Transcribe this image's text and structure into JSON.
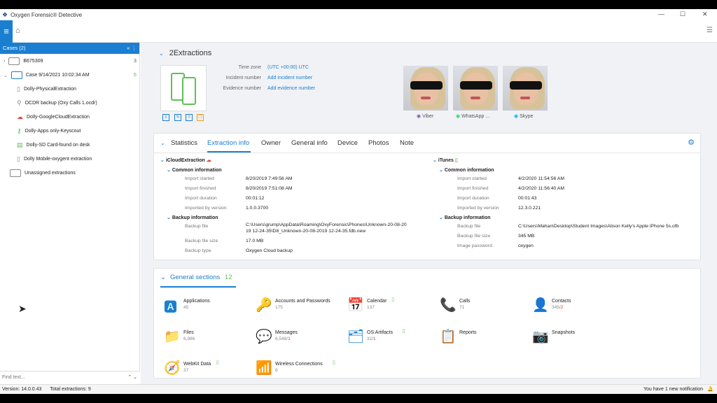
{
  "app": {
    "title": "Oxygen Forensic® Detective"
  },
  "sidebar": {
    "header": "Cases (2)",
    "items": [
      {
        "label": "B675309",
        "count": "3"
      },
      {
        "label": "Case 9/14/2021 10:02:34 AM",
        "count": "6"
      },
      {
        "label": "Dolly-PhysicalExtraction"
      },
      {
        "label": "OCDR backup (Oxy Calls 1.ocdr)"
      },
      {
        "label": "Dolly-GoogleCloudExtraction"
      },
      {
        "label": "Dolly-Apps only-Keyscout"
      },
      {
        "label": "Dolly-SD Card-found on desk"
      },
      {
        "label": "Dolly Mobile-oxygent extraction"
      },
      {
        "label": "Unassigned extractions"
      }
    ],
    "find_placeholder": "Find text..."
  },
  "status": {
    "version": "Version: 14.0.0.43",
    "total": "Total extractions: 9",
    "notification": "You have 1 new notification"
  },
  "extraction": {
    "title": "2Extractions",
    "info": [
      {
        "label": "Time zone",
        "value": "(UTC +00:00) UTC"
      },
      {
        "label": "Incident number",
        "value": "Add incident number"
      },
      {
        "label": "Evidence number",
        "value": "Add evidence number"
      }
    ],
    "apps": [
      "Viber",
      "WhatsApp ...",
      "Skype"
    ]
  },
  "tabs": [
    "Statistics",
    "Extraction info",
    "Owner",
    "General info",
    "Device",
    "Photos",
    "Note"
  ],
  "icloud": {
    "title": "iCloudExtraction",
    "common": "Common information",
    "backup": "Backup information",
    "rows": [
      {
        "k": "Import started",
        "v": "8/20/2019 7:49:56 AM"
      },
      {
        "k": "Import finished",
        "v": "8/20/2019 7:51:08 AM"
      },
      {
        "k": "Import duration",
        "v": "00:01:12"
      },
      {
        "k": "Imported by version",
        "v": "1.0.0.3700"
      }
    ],
    "brows": [
      {
        "k": "Backup file",
        "v1": "C:\\Users\\grump\\AppData\\Roaming\\OxyForensic\\Phones\\Unknown-20-08-20",
        "v2": "19 12-24-35\\D8_Unknown-20-08-2019 12-24-35.fdb.new"
      },
      {
        "k": "Backup file size",
        "v": "17.0 MB"
      },
      {
        "k": "Backup type",
        "v": "Oxygen Cloud backup"
      }
    ]
  },
  "itunes": {
    "title": "iTunes",
    "common": "Common information",
    "backup": "Backup information",
    "rows": [
      {
        "k": "Import started",
        "v": "4/2/2020 11:54:56 AM"
      },
      {
        "k": "Import finished",
        "v": "4/2/2020 11:56:40 AM"
      },
      {
        "k": "Import duration",
        "v": "00:01:43"
      },
      {
        "k": "Imported by version",
        "v": "12.3.0.221"
      }
    ],
    "brows": [
      {
        "k": "Backup file",
        "v": "C:\\Users\\Mahan\\Desktop\\Student Images\\Alison Kelly's Apple iPhone 5s.ofb"
      },
      {
        "k": "Backup file size",
        "v": "345 MB"
      },
      {
        "k": "Image password",
        "v": "oxygen"
      }
    ]
  },
  "general": {
    "title": "General sections",
    "count": "12",
    "items": [
      {
        "name": "Applications",
        "count": "45",
        "red": "",
        "icon": "applications-icon",
        "glyph": "🅰"
      },
      {
        "name": "Accounts and Passwords",
        "count": "175",
        "red": "",
        "icon": "key-icon",
        "glyph": "🔑"
      },
      {
        "name": "Calendar",
        "count": "137",
        "red": "",
        "icon": "calendar-icon",
        "glyph": "📅"
      },
      {
        "name": "Calls",
        "count": "71",
        "red": "",
        "icon": "phone-icon",
        "glyph": "📞"
      },
      {
        "name": "Contacts",
        "count": "345/",
        "red": "2",
        "icon": "contacts-icon",
        "glyph": "👤"
      },
      {
        "name": "Files",
        "count": "6,986",
        "red": "",
        "icon": "folder-icon",
        "glyph": "📁"
      },
      {
        "name": "Messages",
        "count": "6,548/",
        "red": "1",
        "icon": "messages-icon",
        "glyph": "💬"
      },
      {
        "name": "OS Artifacts",
        "count": "32/",
        "red": "1",
        "icon": "os-artifacts-icon",
        "glyph": "🗂"
      },
      {
        "name": "Reports",
        "count": "",
        "red": "",
        "icon": "reports-icon",
        "glyph": "📋"
      },
      {
        "name": "Snapshots",
        "count": "",
        "red": "",
        "icon": "camera-icon",
        "glyph": "📷"
      },
      {
        "name": "WebKit Data",
        "count": "37",
        "red": "",
        "icon": "compass-icon",
        "glyph": "🧭"
      },
      {
        "name": "Wireless Connections",
        "count": "6",
        "red": "",
        "icon": "wifi-icon",
        "glyph": "📶"
      }
    ]
  }
}
